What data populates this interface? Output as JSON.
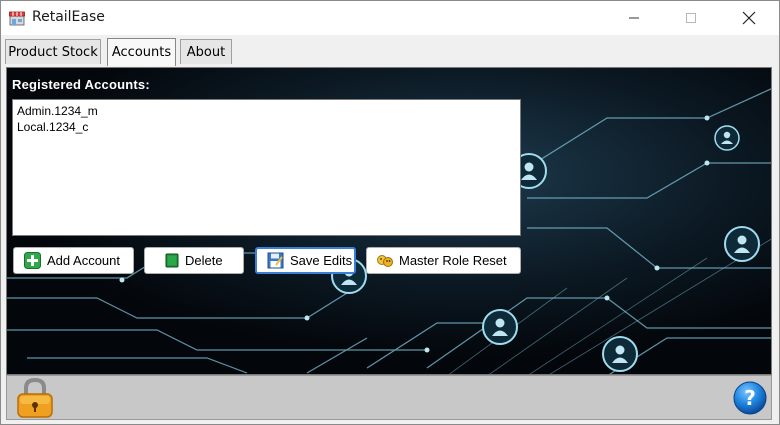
{
  "window": {
    "title": "RetailEase",
    "icon": "store-icon",
    "controls": [
      "minimize",
      "maximize",
      "close"
    ]
  },
  "tabs": [
    {
      "label": "Product Stock",
      "selected": false
    },
    {
      "label": "Accounts",
      "selected": true
    },
    {
      "label": "About",
      "selected": false
    }
  ],
  "accounts": {
    "heading": "Registered Accounts:",
    "items": [
      "Admin.1234_m",
      "Local.1234_c"
    ]
  },
  "buttons": {
    "add": {
      "label": "Add Account",
      "icon": "add-icon"
    },
    "delete": {
      "label": "Delete",
      "icon": "book-icon"
    },
    "save": {
      "label": "Save Edits",
      "icon": "save-icon"
    },
    "reset": {
      "label": "Master Role Reset",
      "icon": "reset-icon"
    }
  },
  "bottom": {
    "left_icon": "lock-icon",
    "right_icon": "help-icon"
  },
  "colors": {
    "panel_bg": "#05080d",
    "circuit": "#9fd4e6",
    "save_focus": "#3a7fd5",
    "help": "#1f86e0",
    "lock": "#f0a020"
  }
}
